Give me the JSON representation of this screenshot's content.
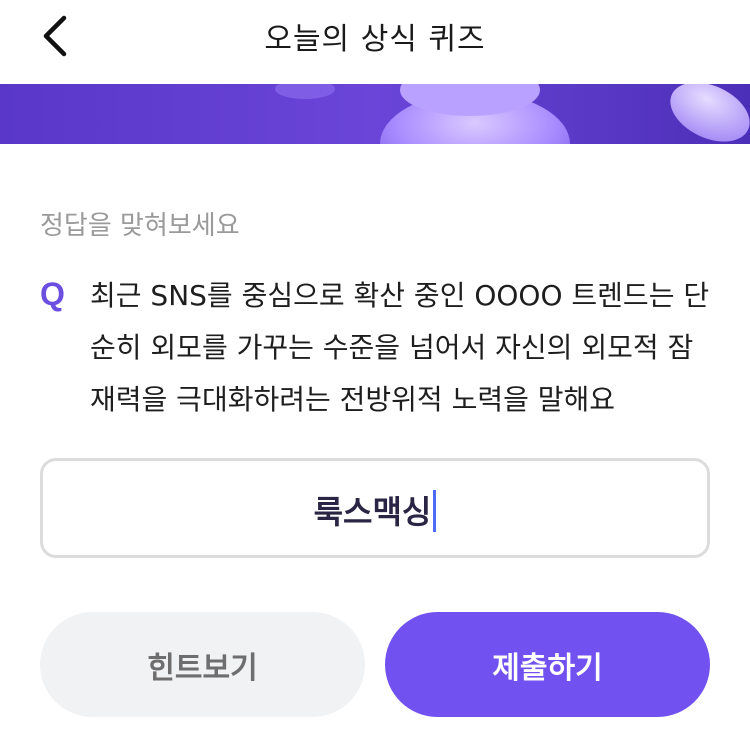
{
  "header": {
    "title": "오늘의 상식 퀴즈",
    "back_icon": "chevron-left-icon"
  },
  "banner": {
    "colors": [
      "#5a37c8",
      "#7b55e6",
      "#b49cff"
    ]
  },
  "quiz": {
    "prompt": "정답을 맞혀보세요",
    "q_marker": "Q",
    "question": "최근 SNS를 중심으로 확산 중인 OOOO 트렌드는 단순히 외모를 가꾸는 수준을 넘어서 자신의 외모적 잠재력을 극대화하려는 전방위적 노력을 말해요"
  },
  "answer": {
    "value": "룩스맥싱"
  },
  "actions": {
    "hint_label": "힌트보기",
    "submit_label": "제출하기"
  },
  "colors": {
    "accent": "#7152f0",
    "q_marker": "#6b4fe0",
    "caret": "#4a6cf7"
  }
}
